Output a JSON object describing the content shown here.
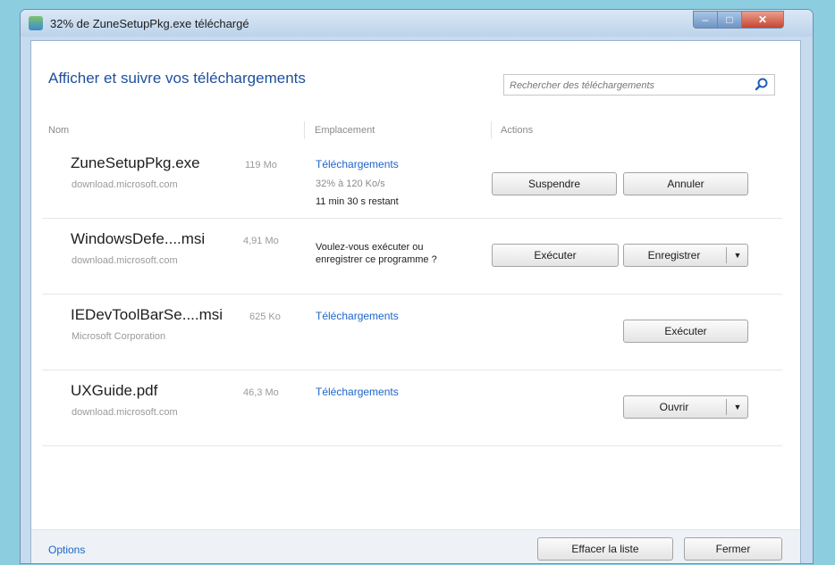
{
  "window": {
    "title": "32% de ZuneSetupPkg.exe téléchargé"
  },
  "header": {
    "title": "Afficher et suivre vos téléchargements",
    "search_placeholder": "Rechercher des téléchargements"
  },
  "columns": {
    "name": "Nom",
    "location": "Emplacement",
    "actions": "Actions"
  },
  "downloads": [
    {
      "name": "ZuneSetupPkg.exe",
      "size": "119 Mo",
      "source": "download.microsoft.com",
      "location": "Téléchargements",
      "progress_text": "32% à 120 Ko/s",
      "progress_percent": 32,
      "remaining": "11 min 30 s restant",
      "actions": [
        "Suspendre",
        "Annuler"
      ]
    },
    {
      "name": "WindowsDefe....msi",
      "size": "4,91 Mo",
      "source": "download.microsoft.com",
      "prompt_line1": "Voulez-vous exécuter ou",
      "prompt_line2": "enregistrer ce programme ?",
      "actions": [
        "Exécuter",
        "Enregistrer"
      ]
    },
    {
      "name": "IEDevToolBarSe....msi",
      "size": "625 Ko",
      "source": "Microsoft Corporation",
      "location": "Téléchargements",
      "actions": [
        "Exécuter"
      ]
    },
    {
      "name": "UXGuide.pdf",
      "size": "46,3 Mo",
      "source": "download.microsoft.com",
      "location": "Téléchargements",
      "actions": [
        "Ouvrir"
      ]
    }
  ],
  "footer": {
    "options": "Options",
    "clear": "Effacer la liste",
    "close": "Fermer"
  },
  "icons": {
    "app": "download-icon",
    "search": "search-icon",
    "dropdown": "chevron-down-icon"
  },
  "colors": {
    "link": "#1e64c8",
    "heading": "#1e4f9c",
    "close_button": "#c84532"
  }
}
